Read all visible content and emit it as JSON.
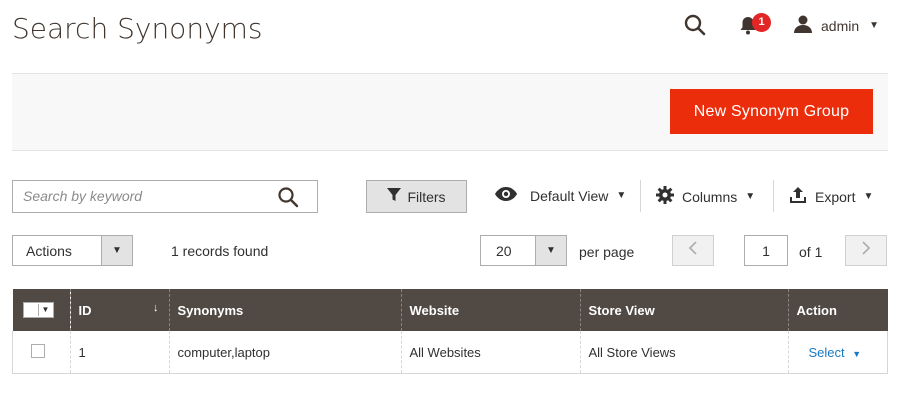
{
  "header": {
    "title": "Search Synonyms",
    "notification_count": "1",
    "user_name": "admin"
  },
  "actions": {
    "new_button_label": "New Synonym Group"
  },
  "toolbar": {
    "search_placeholder": "Search by keyword",
    "filters_label": "Filters",
    "view_label": "Default View",
    "columns_label": "Columns",
    "export_label": "Export"
  },
  "grid_controls": {
    "mass_actions_label": "Actions",
    "records_found": "1 records found",
    "per_page_value": "20",
    "per_page_label": "per page",
    "current_page": "1",
    "page_total": "of 1"
  },
  "grid": {
    "columns": [
      "ID",
      "Synonyms",
      "Website",
      "Store View",
      "Action"
    ],
    "sort_indicator": "↓",
    "rows": [
      {
        "id": "1",
        "synonyms": "computer,laptop",
        "website": "All Websites",
        "store_view": "All Store Views",
        "action_label": "Select"
      }
    ]
  },
  "colors": {
    "primary_button": "#eb2d0c",
    "grid_header": "#514943",
    "link": "#1979c3",
    "badge": "#e22626"
  }
}
